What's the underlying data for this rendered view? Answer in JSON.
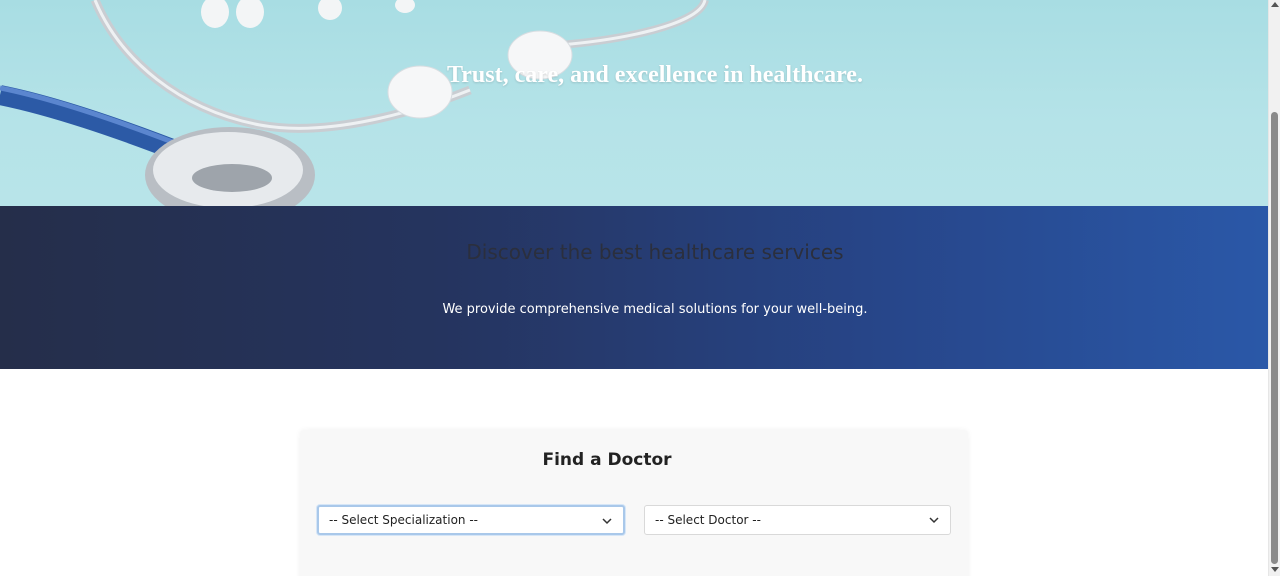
{
  "hero": {
    "tagline": "Trust, care, and excellence in healthcare."
  },
  "band": {
    "heading": "Discover the best healthcare services",
    "subtext": "We provide comprehensive medical solutions for your well-being."
  },
  "finder": {
    "title": "Find a Doctor",
    "specialization_select": {
      "value": "-- Select Specialization --"
    },
    "doctor_select": {
      "value": "-- Select Doctor --"
    }
  },
  "icons": {
    "chevron": "chevron-down-icon",
    "hero_image": "stethoscope-image"
  },
  "colors": {
    "band_start": "#252e4a",
    "band_end": "#2a58a8",
    "hero_bg": "#b5e3e8",
    "focus_ring": "#a9c8ea"
  }
}
